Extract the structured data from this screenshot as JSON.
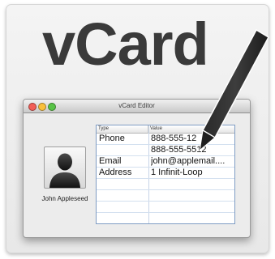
{
  "banner": {
    "title": "vCard"
  },
  "window": {
    "title": "vCard Editor"
  },
  "contact": {
    "name": "John Appleseed"
  },
  "table": {
    "headers": {
      "type": "Type",
      "value": "Value"
    },
    "rows": [
      {
        "type": "Phone",
        "value": "888-555-12"
      },
      {
        "type": "",
        "value": "888-555-5512"
      },
      {
        "type": "Email",
        "value": "john@applemail...."
      },
      {
        "type": "Address",
        "value": "1 Infinit-Loop"
      },
      {
        "type": "",
        "value": ""
      },
      {
        "type": "",
        "value": ""
      },
      {
        "type": "",
        "value": ""
      },
      {
        "type": "",
        "value": ""
      }
    ]
  },
  "icons": {
    "avatar": "person-silhouette-icon",
    "pencil": "pencil-icon"
  }
}
